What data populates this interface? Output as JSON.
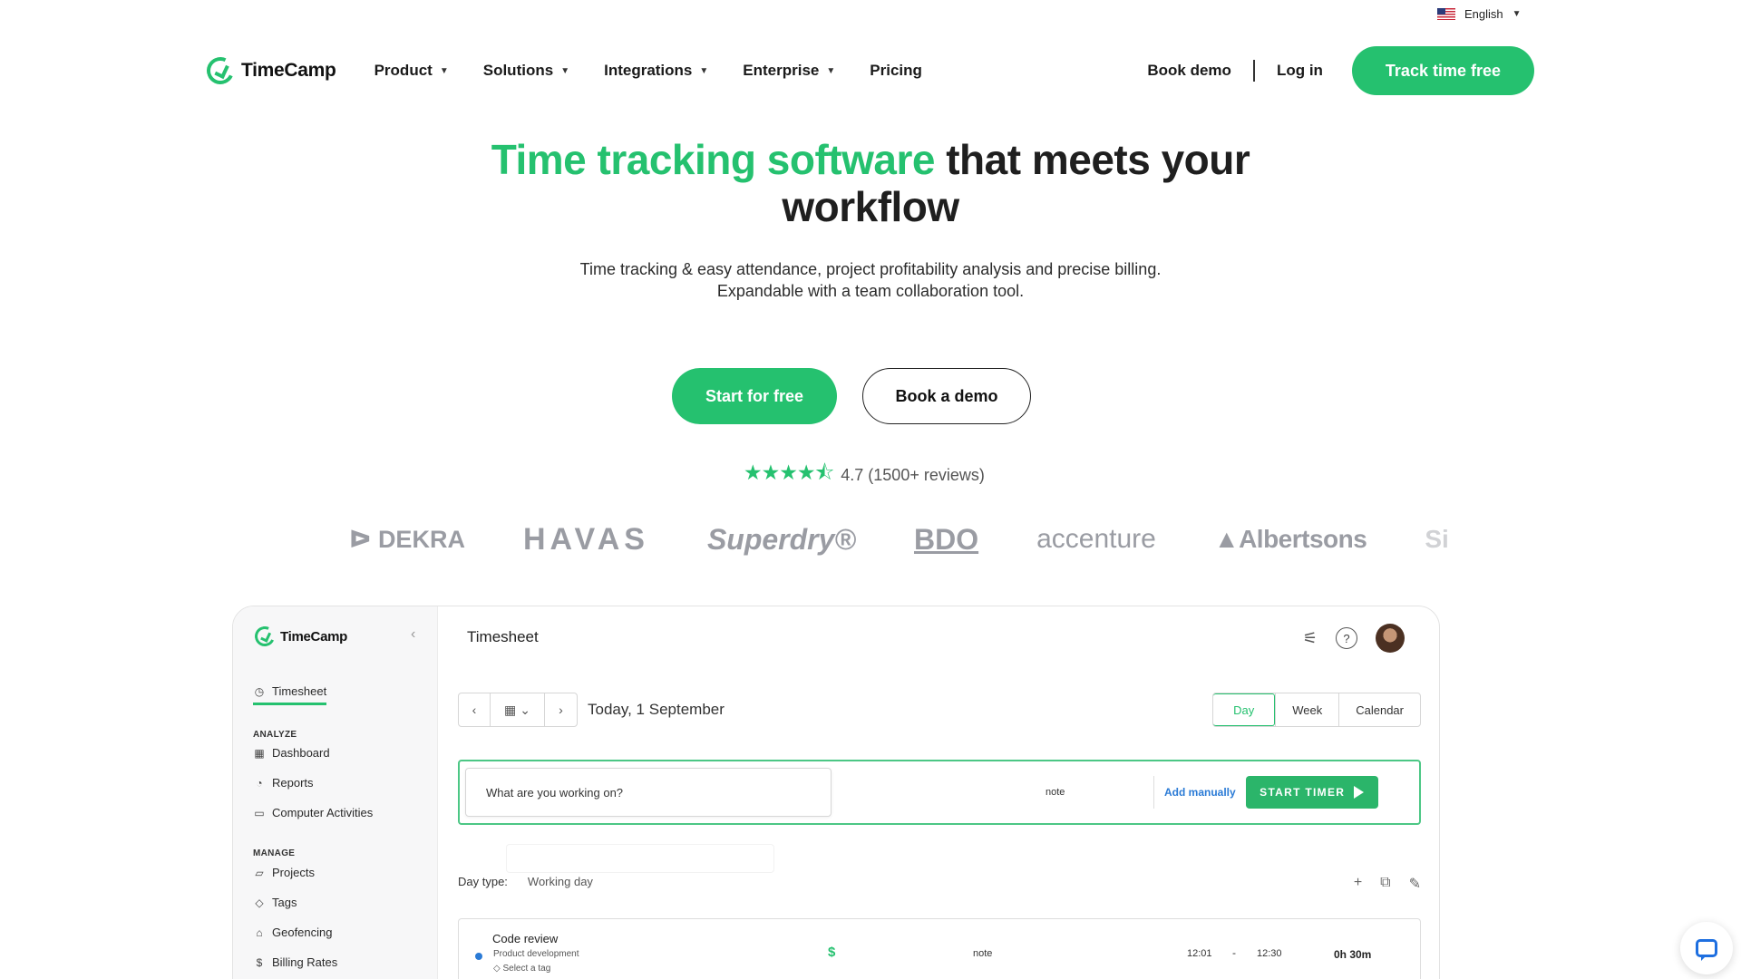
{
  "lang": {
    "label": "English"
  },
  "nav": {
    "logo": "TimeCamp",
    "menu": [
      "Product",
      "Solutions",
      "Integrations",
      "Enterprise",
      "Pricing"
    ],
    "book_demo": "Book demo",
    "login": "Log in",
    "cta": "Track time free"
  },
  "hero": {
    "title_green": "Time tracking software",
    "title_rest": "that meets your workflow",
    "subtitle": "Time tracking & easy attendance, project profitability analysis and precise billing. Expandable with a team collaboration tool.",
    "start": "Start for free",
    "demo": "Book a demo",
    "rating_stars": 4.5,
    "rating_text": "4.7 (1500+ reviews)"
  },
  "logos": [
    "DEKRA",
    "HAVAS",
    "Superdry®",
    "BDO",
    "accenture",
    "Albertsons",
    "Si"
  ],
  "app": {
    "logo": "TimeCamp",
    "sidebar": {
      "active": "Timesheet",
      "analyze_heading": "ANALYZE",
      "analyze": [
        "Dashboard",
        "Reports",
        "Computer Activities"
      ],
      "manage_heading": "MANAGE",
      "manage": [
        "Projects",
        "Tags",
        "Geofencing",
        "Billing Rates"
      ]
    },
    "title": "Timesheet",
    "date": "Today, 1 September",
    "views": [
      "Day",
      "Week",
      "Calendar"
    ],
    "timer": {
      "placeholder": "What are you working on?",
      "note": "note",
      "add_manually": "Add manually",
      "start": "START TIMER"
    },
    "day_type_label": "Day type:",
    "day_type_value": "Working day",
    "entry": {
      "title": "Code review",
      "project": "Product development",
      "tag": "Select a tag",
      "billable": "$",
      "note": "note",
      "start": "12:01",
      "dash": "-",
      "end": "12:30",
      "duration": "0h 30m"
    }
  },
  "colors": {
    "brand_green": "#25c16f",
    "link_blue": "#2b7bd6"
  }
}
